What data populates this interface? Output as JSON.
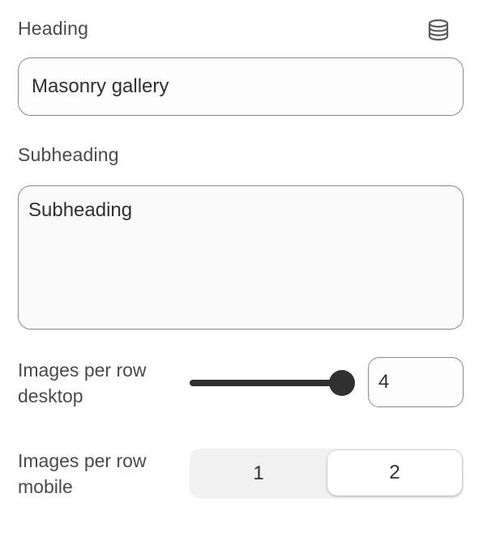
{
  "heading": {
    "label": "Heading",
    "value": "Masonry gallery",
    "icon": "database-icon"
  },
  "subheading": {
    "label": "Subheading",
    "value": "Subheading"
  },
  "images_per_row_desktop": {
    "label_line1": "Images per row",
    "label_line2": "desktop",
    "slider_fraction": 1.0,
    "value": "4"
  },
  "images_per_row_mobile": {
    "label_line1": "Images per row",
    "label_line2": "mobile",
    "options": [
      "1",
      "2"
    ],
    "selected": "2"
  },
  "colors": {
    "text": "#303030",
    "border": "#8a8a8a",
    "slider_fill": "#303030",
    "segment_bg": "#f1f1f1"
  }
}
